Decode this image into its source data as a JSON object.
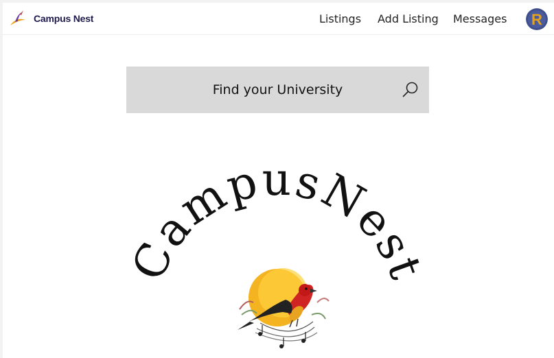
{
  "brand": {
    "name": "Campus Nest",
    "icon": "bird-logo-icon"
  },
  "nav": {
    "listings": "Listings",
    "add_listing": "Add Listing",
    "messages": "Messages"
  },
  "avatar": {
    "initial": "R"
  },
  "search": {
    "placeholder": "Find your University",
    "icon": "search-icon"
  },
  "hero_logo": {
    "text": "CampusNest",
    "icon": "red-bird-illustration"
  },
  "colors": {
    "brand_text": "#1d1b4b",
    "search_bg": "#d9d9d9",
    "avatar_bg": "#3f4f8c",
    "avatar_letter": "#e6a21a"
  }
}
